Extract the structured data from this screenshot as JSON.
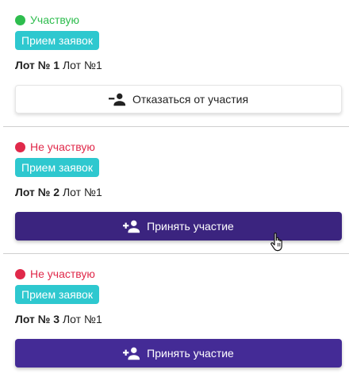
{
  "colors": {
    "participating": "#2ebd4e",
    "not_participating": "#e0294a",
    "badge": "#2ec8cf",
    "primary": "#442b96"
  },
  "lots": [
    {
      "status": "Участвую",
      "status_color": "#2ebd4e",
      "badge": "Прием заявок",
      "title_num": "Лот № 1",
      "title_name": "Лот №1",
      "button_label": "Отказаться от участия",
      "button_icon": "person-remove-icon"
    },
    {
      "status": "Не участвую",
      "status_color": "#e0294a",
      "badge": "Прием заявок",
      "title_num": "Лот № 2",
      "title_name": "Лот №1",
      "button_label": "Принять участие",
      "button_icon": "person-add-icon"
    },
    {
      "status": "Не участвую",
      "status_color": "#e0294a",
      "badge": "Прием заявок",
      "title_num": "Лот № 3",
      "title_name": "Лот №1",
      "button_label": "Принять участие",
      "button_icon": "person-add-icon"
    }
  ]
}
